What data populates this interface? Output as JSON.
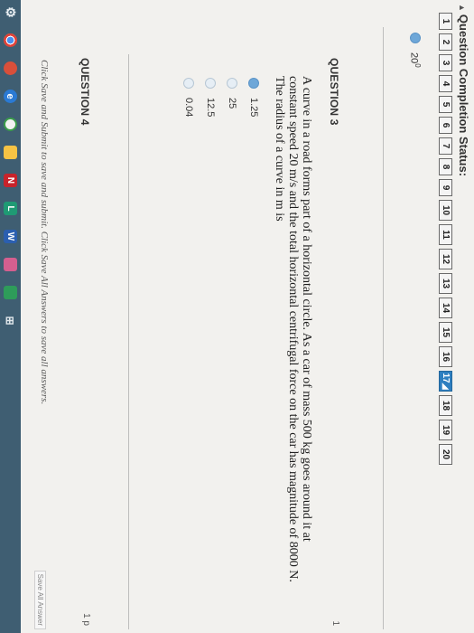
{
  "status": {
    "title": "Question Completion Status:",
    "caret": "▲",
    "questions": [
      "1",
      "2",
      "3",
      "4",
      "5",
      "6",
      "7",
      "8",
      "9",
      "10",
      "11",
      "12",
      "13",
      "14",
      "15",
      "16",
      "17",
      "18",
      "19",
      "20"
    ],
    "current_marker": "◢"
  },
  "previous_answer": {
    "value": "20",
    "sup": "0"
  },
  "question3": {
    "label": "QUESTION 3",
    "number": "1",
    "text": "A curve in a road forms part of a horizontal circle. As a car of mass 500 kg goes around it at constant speed 20 m/s and the total horizontal centrifugal force on the car has magnitude of 8000 N. The radius of a curve in m is",
    "options": [
      "1.25",
      "25",
      "12.5",
      "0.04"
    ]
  },
  "question4": {
    "label": "QUESTION 4",
    "number": "1 p"
  },
  "footer": {
    "note": "Click Save and Submit to save and submit. Click Save All Answers to save all answers.",
    "save_all": "Save All Answer"
  },
  "taskbar": {
    "icons": [
      "settings-icon",
      "chrome-icon",
      "photos-icon",
      "edge-icon",
      "webstore-icon",
      "files-icon",
      "onenote-icon",
      "lync-icon",
      "word-icon",
      "gallery-icon",
      "sheets-icon",
      "grid-icon"
    ],
    "labels": {
      "settings": "⚙",
      "edge": "e",
      "onenote": "N",
      "lync": "L",
      "word": "W",
      "grid": "⊞"
    }
  },
  "colors": {
    "accent": "#2e7fc0",
    "taskbar": "#3f5e72",
    "radio_selected": "#6ea7d8"
  }
}
